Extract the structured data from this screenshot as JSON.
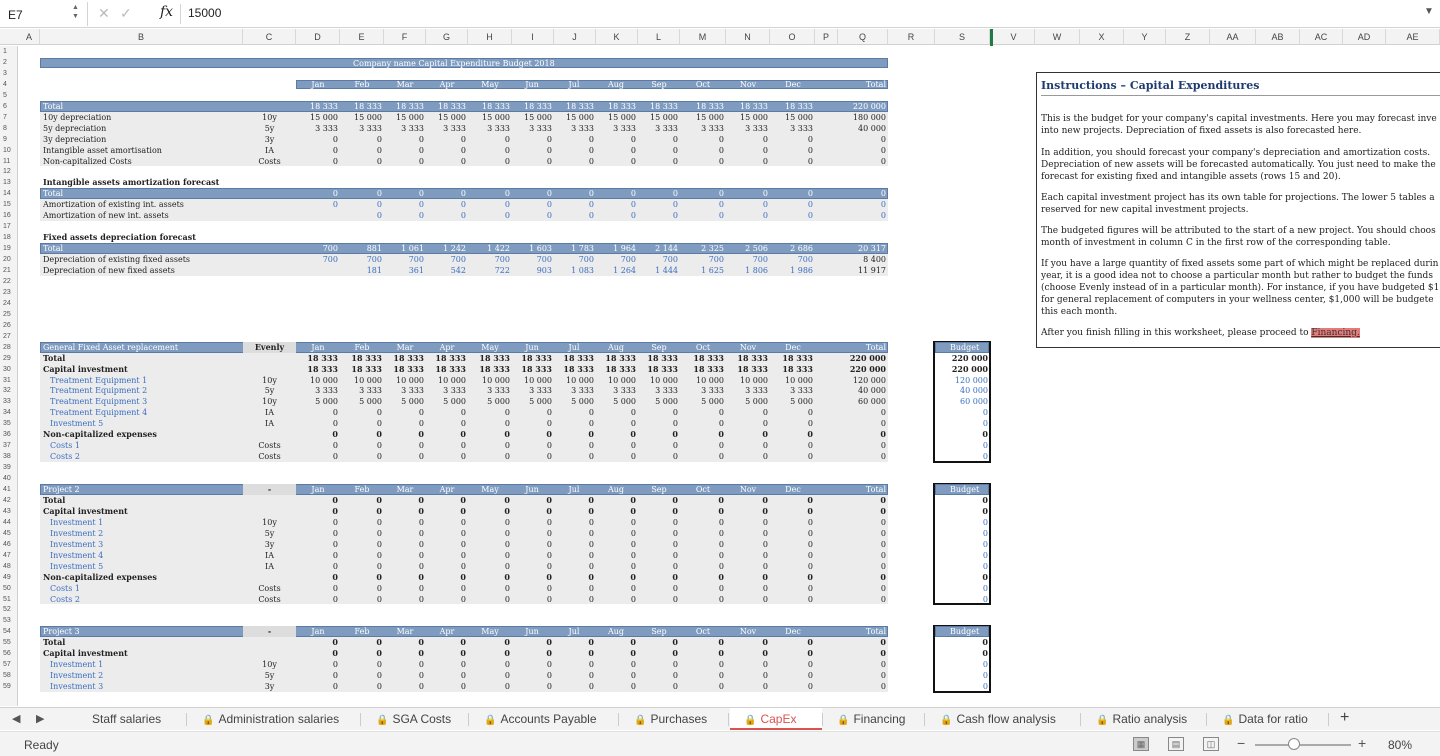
{
  "formula_bar": {
    "cell_ref": "E7",
    "fx": "fx",
    "value": "15000"
  },
  "columns": [
    "A",
    "B",
    "C",
    "D",
    "E",
    "F",
    "G",
    "H",
    "I",
    "J",
    "K",
    "L",
    "M",
    "N",
    "O",
    "P",
    "Q",
    "R",
    "S",
    "V",
    "W",
    "X",
    "Y",
    "Z",
    "AA",
    "AB",
    "AC",
    "AD",
    "AE"
  ],
  "rows": [
    1,
    2,
    3,
    4,
    5,
    6,
    7,
    8,
    9,
    10,
    11,
    12,
    13,
    14,
    15,
    16,
    17,
    18,
    19,
    20,
    21,
    22,
    23,
    24,
    25,
    26,
    27,
    28,
    29,
    30,
    31,
    32,
    33,
    34,
    35,
    36,
    37,
    38,
    39,
    40,
    41,
    42,
    43,
    44,
    45,
    46,
    47,
    48,
    49,
    50,
    51,
    52,
    53,
    54,
    55,
    56,
    57,
    58,
    59
  ],
  "title": "Company name Capital Expenditure Budget 2018",
  "months": [
    "Jan",
    "Feb",
    "Mar",
    "Apr",
    "May",
    "Jun",
    "Jul",
    "Aug",
    "Sep",
    "Oct",
    "Nov",
    "Dec"
  ],
  "total_label": "Total",
  "budget_label": "Budget",
  "summary_rows": [
    {
      "label": "Total",
      "type": "",
      "vals": [
        "18 333",
        "18 333",
        "18 333",
        "18 333",
        "18 333",
        "18 333",
        "18 333",
        "18 333",
        "18 333",
        "18 333",
        "18 333",
        "18 333"
      ],
      "total": "220 000",
      "header": true
    },
    {
      "label": "10y depreciation",
      "type": "10y",
      "vals": [
        "15 000",
        "15 000",
        "15 000",
        "15 000",
        "15 000",
        "15 000",
        "15 000",
        "15 000",
        "15 000",
        "15 000",
        "15 000",
        "15 000"
      ],
      "total": "180 000"
    },
    {
      "label": "5y depreciation",
      "type": "5y",
      "vals": [
        "3 333",
        "3 333",
        "3 333",
        "3 333",
        "3 333",
        "3 333",
        "3 333",
        "3 333",
        "3 333",
        "3 333",
        "3 333",
        "3 333"
      ],
      "total": "40 000"
    },
    {
      "label": "3y depreciation",
      "type": "3y",
      "vals": [
        "0",
        "0",
        "0",
        "0",
        "0",
        "0",
        "0",
        "0",
        "0",
        "0",
        "0",
        "0"
      ],
      "total": "0"
    },
    {
      "label": "Intangible asset amortisation",
      "type": "IA",
      "vals": [
        "0",
        "0",
        "0",
        "0",
        "0",
        "0",
        "0",
        "0",
        "0",
        "0",
        "0",
        "0"
      ],
      "total": "0"
    },
    {
      "label": "Non-capitalized Costs",
      "type": "Costs",
      "vals": [
        "0",
        "0",
        "0",
        "0",
        "0",
        "0",
        "0",
        "0",
        "0",
        "0",
        "0",
        "0"
      ],
      "total": "0"
    }
  ],
  "intangible": {
    "title": "Intangible assets amortization forecast",
    "rows": [
      {
        "label": "Total",
        "first": "0",
        "vals": [
          "0",
          "0",
          "0",
          "0",
          "0",
          "0",
          "0",
          "0",
          "0",
          "0",
          "0",
          "0"
        ],
        "total": "0",
        "header": true
      },
      {
        "label": "Amortization of existing int. assets",
        "first": "0",
        "vals": [
          "0",
          "0",
          "0",
          "0",
          "0",
          "0",
          "0",
          "0",
          "0",
          "0",
          "0",
          "0"
        ],
        "total": "0"
      },
      {
        "label": "Amortization of new int. assets",
        "first": "",
        "vals": [
          "0",
          "0",
          "0",
          "0",
          "0",
          "0",
          "0",
          "0",
          "0",
          "0",
          "0",
          "0"
        ],
        "total": "0"
      }
    ]
  },
  "fixed": {
    "title": "Fixed assets depreciation forecast",
    "rows": [
      {
        "label": "Total",
        "first": "700",
        "vals": [
          "881",
          "1 061",
          "1 242",
          "1 422",
          "1 603",
          "1 783",
          "1 964",
          "2 144",
          "2 325",
          "2 506",
          "2 686"
        ],
        "total": "20 317",
        "header": true
      },
      {
        "label": "Depreciation of existing fixed assets",
        "first": "700",
        "vals": [
          "700",
          "700",
          "700",
          "700",
          "700",
          "700",
          "700",
          "700",
          "700",
          "700",
          "700"
        ],
        "total": "8 400"
      },
      {
        "label": "Depreciation of new fixed assets",
        "first": "",
        "vals": [
          "181",
          "361",
          "542",
          "722",
          "903",
          "1 083",
          "1 264",
          "1 444",
          "1 625",
          "1 806",
          "1 986"
        ],
        "total": "11 917"
      }
    ]
  },
  "projects": [
    {
      "name": "General Fixed Asset replacement",
      "month": "Evenly",
      "rows": [
        {
          "label": "Total",
          "type": "",
          "vals": [
            "18 333",
            "18 333",
            "18 333",
            "18 333",
            "18 333",
            "18 333",
            "18 333",
            "18 333",
            "18 333",
            "18 333",
            "18 333",
            "18 333"
          ],
          "total": "220 000",
          "budget": "220 000",
          "bold": true
        },
        {
          "label": "Capital investment",
          "type": "",
          "vals": [
            "18 333",
            "18 333",
            "18 333",
            "18 333",
            "18 333",
            "18 333",
            "18 333",
            "18 333",
            "18 333",
            "18 333",
            "18 333",
            "18 333"
          ],
          "total": "220 000",
          "budget": "220 000",
          "bold": true
        },
        {
          "label": "Treatment Equipment 1",
          "type": "10y",
          "vals": [
            "10 000",
            "10 000",
            "10 000",
            "10 000",
            "10 000",
            "10 000",
            "10 000",
            "10 000",
            "10 000",
            "10 000",
            "10 000",
            "10 000"
          ],
          "total": "120 000",
          "budget": "120 000",
          "sub": true
        },
        {
          "label": "Treatment Equipment 2",
          "type": "5y",
          "vals": [
            "3 333",
            "3 333",
            "3 333",
            "3 333",
            "3 333",
            "3 333",
            "3 333",
            "3 333",
            "3 333",
            "3 333",
            "3 333",
            "3 333"
          ],
          "total": "40 000",
          "budget": "40 000",
          "sub": true
        },
        {
          "label": "Treatment Equipment 3",
          "type": "10y",
          "vals": [
            "5 000",
            "5 000",
            "5 000",
            "5 000",
            "5 000",
            "5 000",
            "5 000",
            "5 000",
            "5 000",
            "5 000",
            "5 000",
            "5 000"
          ],
          "total": "60 000",
          "budget": "60 000",
          "sub": true
        },
        {
          "label": "Treatment Equipment 4",
          "type": "IA",
          "vals": [
            "0",
            "0",
            "0",
            "0",
            "0",
            "0",
            "0",
            "0",
            "0",
            "0",
            "0",
            "0"
          ],
          "total": "0",
          "budget": "0",
          "sub": true
        },
        {
          "label": "Investment 5",
          "type": "IA",
          "vals": [
            "0",
            "0",
            "0",
            "0",
            "0",
            "0",
            "0",
            "0",
            "0",
            "0",
            "0",
            "0"
          ],
          "total": "0",
          "budget": "0",
          "sub": true
        },
        {
          "label": "Non-capitalized expenses",
          "type": "",
          "vals": [
            "0",
            "0",
            "0",
            "0",
            "0",
            "0",
            "0",
            "0",
            "0",
            "0",
            "0",
            "0"
          ],
          "total": "0",
          "budget": "0",
          "bold": true
        },
        {
          "label": "Costs 1",
          "type": "Costs",
          "vals": [
            "0",
            "0",
            "0",
            "0",
            "0",
            "0",
            "0",
            "0",
            "0",
            "0",
            "0",
            "0"
          ],
          "total": "0",
          "budget": "0",
          "sub": true
        },
        {
          "label": "Costs 2",
          "type": "Costs",
          "vals": [
            "0",
            "0",
            "0",
            "0",
            "0",
            "0",
            "0",
            "0",
            "0",
            "0",
            "0",
            "0"
          ],
          "total": "0",
          "budget": "0",
          "sub": true
        }
      ]
    },
    {
      "name": "Project 2",
      "month": "-",
      "rows": [
        {
          "label": "Total",
          "type": "",
          "vals": [
            "0",
            "0",
            "0",
            "0",
            "0",
            "0",
            "0",
            "0",
            "0",
            "0",
            "0",
            "0"
          ],
          "total": "0",
          "budget": "0",
          "bold": true
        },
        {
          "label": "Capital investment",
          "type": "",
          "vals": [
            "0",
            "0",
            "0",
            "0",
            "0",
            "0",
            "0",
            "0",
            "0",
            "0",
            "0",
            "0"
          ],
          "total": "0",
          "budget": "0",
          "bold": true
        },
        {
          "label": "Investment 1",
          "type": "10y",
          "vals": [
            "0",
            "0",
            "0",
            "0",
            "0",
            "0",
            "0",
            "0",
            "0",
            "0",
            "0",
            "0"
          ],
          "total": "0",
          "budget": "0",
          "sub": true
        },
        {
          "label": "Investment 2",
          "type": "5y",
          "vals": [
            "0",
            "0",
            "0",
            "0",
            "0",
            "0",
            "0",
            "0",
            "0",
            "0",
            "0",
            "0"
          ],
          "total": "0",
          "budget": "0",
          "sub": true
        },
        {
          "label": "Investment 3",
          "type": "3y",
          "vals": [
            "0",
            "0",
            "0",
            "0",
            "0",
            "0",
            "0",
            "0",
            "0",
            "0",
            "0",
            "0"
          ],
          "total": "0",
          "budget": "0",
          "sub": true
        },
        {
          "label": "Investment 4",
          "type": "IA",
          "vals": [
            "0",
            "0",
            "0",
            "0",
            "0",
            "0",
            "0",
            "0",
            "0",
            "0",
            "0",
            "0"
          ],
          "total": "0",
          "budget": "0",
          "sub": true
        },
        {
          "label": "Investment 5",
          "type": "IA",
          "vals": [
            "0",
            "0",
            "0",
            "0",
            "0",
            "0",
            "0",
            "0",
            "0",
            "0",
            "0",
            "0"
          ],
          "total": "0",
          "budget": "0",
          "sub": true
        },
        {
          "label": "Non-capitalized expenses",
          "type": "",
          "vals": [
            "0",
            "0",
            "0",
            "0",
            "0",
            "0",
            "0",
            "0",
            "0",
            "0",
            "0",
            "0"
          ],
          "total": "0",
          "budget": "0",
          "bold": true
        },
        {
          "label": "Costs 1",
          "type": "Costs",
          "vals": [
            "0",
            "0",
            "0",
            "0",
            "0",
            "0",
            "0",
            "0",
            "0",
            "0",
            "0",
            "0"
          ],
          "total": "0",
          "budget": "0",
          "sub": true
        },
        {
          "label": "Costs 2",
          "type": "Costs",
          "vals": [
            "0",
            "0",
            "0",
            "0",
            "0",
            "0",
            "0",
            "0",
            "0",
            "0",
            "0",
            "0"
          ],
          "total": "0",
          "budget": "0",
          "sub": true
        }
      ]
    },
    {
      "name": "Project 3",
      "month": "-",
      "rows": [
        {
          "label": "Total",
          "type": "",
          "vals": [
            "0",
            "0",
            "0",
            "0",
            "0",
            "0",
            "0",
            "0",
            "0",
            "0",
            "0",
            "0"
          ],
          "total": "0",
          "budget": "0",
          "bold": true
        },
        {
          "label": "Capital investment",
          "type": "",
          "vals": [
            "0",
            "0",
            "0",
            "0",
            "0",
            "0",
            "0",
            "0",
            "0",
            "0",
            "0",
            "0"
          ],
          "total": "0",
          "budget": "0",
          "bold": true
        },
        {
          "label": "Investment 1",
          "type": "10y",
          "vals": [
            "0",
            "0",
            "0",
            "0",
            "0",
            "0",
            "0",
            "0",
            "0",
            "0",
            "0",
            "0"
          ],
          "total": "0",
          "budget": "0",
          "sub": true
        },
        {
          "label": "Investment 2",
          "type": "5y",
          "vals": [
            "0",
            "0",
            "0",
            "0",
            "0",
            "0",
            "0",
            "0",
            "0",
            "0",
            "0",
            "0"
          ],
          "total": "0",
          "budget": "0",
          "sub": true
        },
        {
          "label": "Investment 3",
          "type": "3y",
          "vals": [
            "0",
            "0",
            "0",
            "0",
            "0",
            "0",
            "0",
            "0",
            "0",
            "0",
            "0",
            "0"
          ],
          "total": "0",
          "budget": "0",
          "sub": true
        }
      ]
    }
  ],
  "instructions": {
    "title": "Instructions – Capital Expenditures",
    "lines": [
      "This is the budget for your company's capital investments. Here you may forecast inve",
      "into new projects. Depreciation of fixed assets is also forecasted here.",
      "In addition, you should forecast your company's depreciation and amortization costs.",
      "Depreciation of new assets will be forecasted automatically. You just need to make the",
      "forecast for existing fixed and intangible assets (rows 15 and 20).",
      "Each capital investment project has its own table for projections. The lower 5 tables a",
      "reserved for new capital investment projects.",
      "The budgeted figures will be attributed to the start of a new project. You should choos",
      "month of investment in column C in the first row of the corresponding table.",
      "If you have a large quantity of fixed assets some part of which might be replaced durin",
      "year, it is a good idea not to choose a particular month but rather to budget the funds",
      "(choose Evenly instead of in a particular month). For instance, if you have budgeted $1",
      "for general replacement of computers in your wellness center, $1,000 will be budgete",
      "this each month."
    ],
    "final": "After you finish filling in this worksheet, please proceed to ",
    "link": "Financing."
  },
  "tabs": [
    {
      "label": "Staff salaries",
      "locked": false
    },
    {
      "label": "Administration salaries",
      "locked": true
    },
    {
      "label": "SGA Costs",
      "locked": true
    },
    {
      "label": "Accounts Payable",
      "locked": true
    },
    {
      "label": "Purchases",
      "locked": true
    },
    {
      "label": "CapEx",
      "locked": true,
      "active": true
    },
    {
      "label": "Financing",
      "locked": true
    },
    {
      "label": "Cash flow analysis",
      "locked": true
    },
    {
      "label": "Ratio analysis",
      "locked": true
    },
    {
      "label": "Data for ratio",
      "locked": true
    }
  ],
  "status": {
    "ready": "Ready",
    "zoom": "80%"
  },
  "colors": {
    "header_blue": "#7f9cc0",
    "link_red": "#e37b7b",
    "tab_active": "#d9534f",
    "input_blue": "#3b6fc0"
  }
}
